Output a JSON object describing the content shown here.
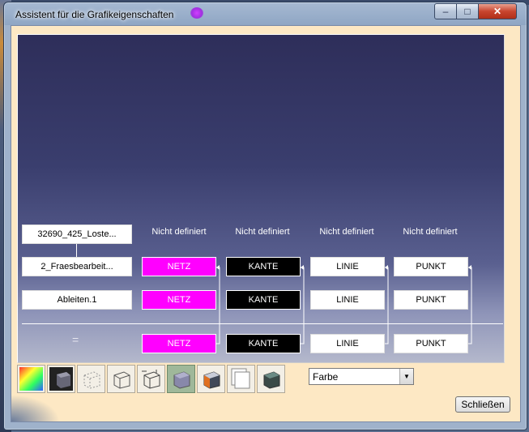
{
  "window": {
    "title": "Assistent für die Grafikeigenschaften",
    "controls": {
      "minimize": "–",
      "maximize": "□",
      "close": "✕"
    }
  },
  "tree": {
    "rows": [
      {
        "label": "32690_425_Loste..."
      },
      {
        "label": "2_Fraesbearbeit..."
      },
      {
        "label": "Ableiten.1"
      }
    ],
    "result_symbol": "="
  },
  "headers": [
    "Nicht definiert",
    "Nicht definiert",
    "Nicht definiert",
    "Nicht definiert"
  ],
  "columns": [
    {
      "label": "NETZ",
      "color": "#ff00ff"
    },
    {
      "label": "KANTE",
      "color": "#000000"
    },
    {
      "label": "LINIE",
      "color": "#ffffff"
    },
    {
      "label": "PUNKT",
      "color": "#ffffff"
    }
  ],
  "toolbar": {
    "icons": [
      "color-wheel-icon",
      "shaded-cube-icon",
      "dotted-cube-icon",
      "wireframe-cube-icon",
      "points-cube-icon",
      "solid-cube-icon",
      "orange-cube-icon",
      "layers-icon",
      "dark-cube-icon"
    ],
    "active_index": 5,
    "dropdown_value": "Farbe"
  },
  "close_button": "Schließen"
}
